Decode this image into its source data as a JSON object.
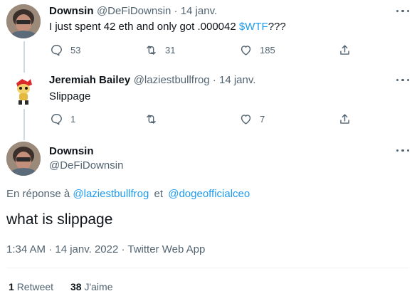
{
  "tweets": [
    {
      "name": "Downsin",
      "handle_time": "@DeFiDownsin · 14 janv.",
      "text_before": "I just spent 42 eth and only got .000042 ",
      "cashtag": "$WTF",
      "text_after": "???",
      "replies": "53",
      "retweets": "31",
      "likes": "185"
    },
    {
      "name": "Jeremiah Bailey",
      "handle_time": "@laziestbullfrog · 14 janv.",
      "text": "Slippage",
      "replies": "1",
      "retweets": "",
      "likes": "7"
    }
  ],
  "focused": {
    "name": "Downsin",
    "handle": "@DeFiDownsin",
    "reply_prefix": "En réponse à",
    "mention1": "@laziestbullfrog",
    "reply_connector": "et",
    "mention2": "@dogeofficialceo",
    "text": "what is slippage",
    "timestamp": "1:34 AM · 14 janv. 2022 · Twitter Web App",
    "retweet_count": "1",
    "retweet_label": "Retweet",
    "like_count": "38",
    "like_label": "J'aime"
  },
  "colors": {
    "link": "#1d9bf0",
    "muted": "#536471",
    "text": "#0f1419"
  }
}
